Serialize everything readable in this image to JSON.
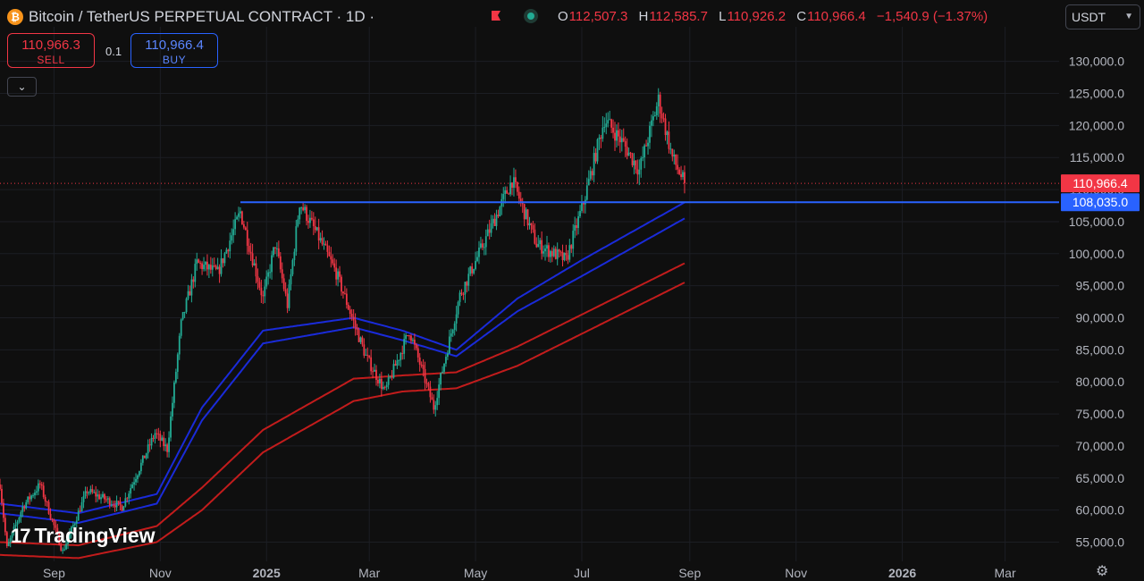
{
  "header": {
    "symbol_title": "Bitcoin / TetherUS PERPETUAL CONTRACT · 1D ·",
    "coin_icon": "bitcoin-icon",
    "ohlc": [
      {
        "key": "O",
        "value": "112,507.3"
      },
      {
        "key": "H",
        "value": "112,585.7"
      },
      {
        "key": "L",
        "value": "110,926.2"
      },
      {
        "key": "C",
        "value": "110,966.4"
      }
    ],
    "change": "−1,540.9 (−1.37%)",
    "currency": "USDT"
  },
  "trade": {
    "sell_price": "110,966.3",
    "sell_label": "SELL",
    "buy_price": "110,966.4",
    "buy_label": "BUY",
    "quantity": "0.1"
  },
  "branding": {
    "name": "TradingView",
    "mark": "17"
  },
  "colors": {
    "up": "#22ab94",
    "down": "#f23645",
    "blue_band": "#1a2bd9",
    "red_band": "#c21c1c",
    "level_line": "#2962ff"
  },
  "chart_data": {
    "type": "candlestick",
    "instrument": "BTCUSDT.P",
    "interval": "1D",
    "ylim": [
      52000,
      134000
    ],
    "y_ticks": [
      "55,000.0",
      "60,000.0",
      "65,000.0",
      "70,000.0",
      "75,000.0",
      "80,000.0",
      "85,000.0",
      "90,000.0",
      "95,000.0",
      "100,000.0",
      "105,000.0",
      "110,000.0",
      "115,000.0",
      "120,000.0",
      "125,000.0",
      "130,000.0"
    ],
    "x_ticks": [
      "Sep",
      "Nov",
      "2025",
      "Mar",
      "May",
      "Jul",
      "Sep",
      "Nov",
      "2026",
      "Mar"
    ],
    "x_range": [
      "2024-08-01",
      "2026-04-01"
    ],
    "x_tick_dates": [
      "2024-09-01",
      "2024-11-01",
      "2025-01-01",
      "2025-03-01",
      "2025-05-01",
      "2025-07-01",
      "2025-09-01",
      "2025-11-01",
      "2026-01-01",
      "2026-03-01"
    ],
    "last_candle_date": "2025-08-29",
    "price_path": [
      [
        "2024-08-01",
        64000
      ],
      [
        "2024-08-05",
        54000
      ],
      [
        "2024-08-14",
        60500
      ],
      [
        "2024-08-24",
        64000
      ],
      [
        "2024-09-06",
        53500
      ],
      [
        "2024-09-20",
        63000
      ],
      [
        "2024-10-10",
        60500
      ],
      [
        "2024-10-29",
        72000
      ],
      [
        "2024-11-05",
        69500
      ],
      [
        "2024-11-13",
        89000
      ],
      [
        "2024-11-22",
        98500
      ],
      [
        "2024-12-04",
        97000
      ],
      [
        "2024-12-17",
        106500
      ],
      [
        "2024-12-30",
        93000
      ],
      [
        "2025-01-06",
        101500
      ],
      [
        "2025-01-13",
        92000
      ],
      [
        "2025-01-20",
        108000
      ],
      [
        "2025-01-31",
        102500
      ],
      [
        "2025-02-10",
        97000
      ],
      [
        "2025-02-27",
        84000
      ],
      [
        "2025-03-10",
        78500
      ],
      [
        "2025-03-24",
        88000
      ],
      [
        "2025-04-07",
        76000
      ],
      [
        "2025-04-22",
        93500
      ],
      [
        "2025-05-08",
        103000
      ],
      [
        "2025-05-22",
        111500
      ],
      [
        "2025-06-05",
        101500
      ],
      [
        "2025-06-22",
        99000
      ],
      [
        "2025-07-02",
        108000
      ],
      [
        "2025-07-14",
        121000
      ],
      [
        "2025-07-24",
        117500
      ],
      [
        "2025-08-03",
        113000
      ],
      [
        "2025-08-14",
        124000
      ],
      [
        "2025-08-22",
        115000
      ],
      [
        "2025-08-29",
        110966.4
      ]
    ],
    "bands": [
      {
        "name": "",
        "color": "#1a2bd9",
        "points": [
          [
            "2024-08-01",
            61000
          ],
          [
            "2024-09-15",
            59500
          ],
          [
            "2024-10-30",
            62500
          ],
          [
            "2024-11-25",
            76000
          ],
          [
            "2024-12-30",
            88000
          ],
          [
            "2025-02-20",
            90000
          ],
          [
            "2025-03-20",
            88000
          ],
          [
            "2025-04-20",
            85000
          ],
          [
            "2025-05-25",
            93000
          ],
          [
            "2025-07-01",
            99000
          ],
          [
            "2025-08-29",
            108000
          ]
        ]
      },
      {
        "name": "",
        "color": "#1a2bd9",
        "points": [
          [
            "2024-08-01",
            59500
          ],
          [
            "2024-09-15",
            58000
          ],
          [
            "2024-10-30",
            61000
          ],
          [
            "2024-11-25",
            74000
          ],
          [
            "2024-12-30",
            86000
          ],
          [
            "2025-02-20",
            88500
          ],
          [
            "2025-03-20",
            86500
          ],
          [
            "2025-04-20",
            84000
          ],
          [
            "2025-05-25",
            91000
          ],
          [
            "2025-07-01",
            96500
          ],
          [
            "2025-08-29",
            105500
          ]
        ]
      },
      {
        "name": "",
        "color": "#c21c1c",
        "points": [
          [
            "2024-08-01",
            55000
          ],
          [
            "2024-09-15",
            54500
          ],
          [
            "2024-10-30",
            57500
          ],
          [
            "2024-11-25",
            63500
          ],
          [
            "2024-12-30",
            72500
          ],
          [
            "2025-02-20",
            80500
          ],
          [
            "2025-03-20",
            81000
          ],
          [
            "2025-04-20",
            81500
          ],
          [
            "2025-05-25",
            85500
          ],
          [
            "2025-07-01",
            90500
          ],
          [
            "2025-08-29",
            98500
          ]
        ]
      },
      {
        "name": "",
        "color": "#c21c1c",
        "points": [
          [
            "2024-08-01",
            53000
          ],
          [
            "2024-09-15",
            52500
          ],
          [
            "2024-10-30",
            55000
          ],
          [
            "2024-11-25",
            60000
          ],
          [
            "2024-12-30",
            69000
          ],
          [
            "2025-02-20",
            77000
          ],
          [
            "2025-03-20",
            78500
          ],
          [
            "2025-04-20",
            79000
          ],
          [
            "2025-05-25",
            82500
          ],
          [
            "2025-07-01",
            87500
          ],
          [
            "2025-08-29",
            95500
          ]
        ]
      }
    ],
    "horizontal_line": {
      "value": 108035.0,
      "label": "108,035.0",
      "start_date": "2024-12-17"
    },
    "current_price": {
      "value": 110966.4,
      "label": "110,966.4"
    }
  }
}
